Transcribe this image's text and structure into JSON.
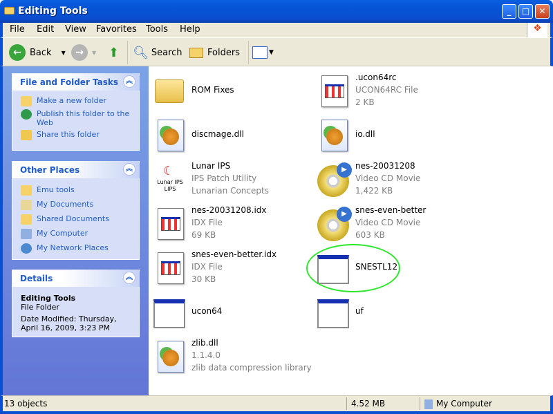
{
  "window": {
    "title": "Editing Tools"
  },
  "menu": [
    "File",
    "Edit",
    "View",
    "Favorites",
    "Tools",
    "Help"
  ],
  "toolbar": {
    "back": "Back",
    "search": "Search",
    "folders": "Folders"
  },
  "tasks": {
    "title": "File and Folder Tasks",
    "items": [
      "Make a new folder",
      "Publish this folder to the Web",
      "Share this folder"
    ]
  },
  "other": {
    "title": "Other Places",
    "items": [
      "Emu tools",
      "My Documents",
      "Shared Documents",
      "My Computer",
      "My Network Places"
    ]
  },
  "details": {
    "title": "Details",
    "name": "Editing Tools",
    "type": "File Folder",
    "modified": "Date Modified: Thursday, April 16, 2009, 3:23 PM"
  },
  "files": [
    {
      "name": "ROM Fixes",
      "lines": [],
      "icon": "folder"
    },
    {
      "name": ".ucon64rc",
      "lines": [
        "UCON64RC File",
        "2 KB"
      ],
      "icon": "doc"
    },
    {
      "name": "discmage.dll",
      "lines": [],
      "icon": "dll"
    },
    {
      "name": "io.dll",
      "lines": [],
      "icon": "dll"
    },
    {
      "name": "Lunar IPS",
      "lines": [
        "IPS Patch Utility",
        "Lunarian Concepts"
      ],
      "icon": "lips",
      "icon_label": "Lunar IPS LIPS"
    },
    {
      "name": "nes-20031208",
      "lines": [
        "Video CD Movie",
        "1,422 KB"
      ],
      "icon": "cd"
    },
    {
      "name": "nes-20031208.idx",
      "lines": [
        "IDX File",
        "69 KB"
      ],
      "icon": "doc"
    },
    {
      "name": "snes-even-better",
      "lines": [
        "Video CD Movie",
        "603 KB"
      ],
      "icon": "cd"
    },
    {
      "name": "snes-even-better.idx",
      "lines": [
        "IDX File",
        "30 KB"
      ],
      "icon": "doc"
    },
    {
      "name": "SNESTL12",
      "lines": [],
      "icon": "exe"
    },
    {
      "name": "ucon64",
      "lines": [],
      "icon": "exe"
    },
    {
      "name": "uf",
      "lines": [],
      "icon": "exe"
    },
    {
      "name": "zlib.dll",
      "lines": [
        "1.1.4.0",
        "zlib data compression library"
      ],
      "icon": "dll"
    }
  ],
  "status": {
    "objects": "13 objects",
    "size": "4.52 MB",
    "location": "My Computer"
  }
}
